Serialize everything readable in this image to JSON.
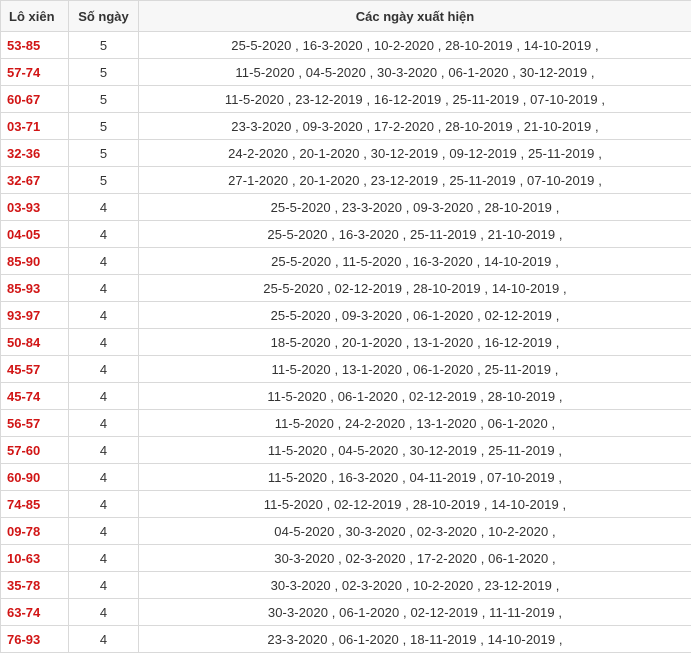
{
  "columns": {
    "pair": "Lô xiên",
    "days": "Số ngày",
    "dates": "Các ngày xuất hiện"
  },
  "colors": {
    "pair_text": "#d11515",
    "border": "#d9d9d9",
    "header_bg": "#f7f7f7"
  },
  "rows": [
    {
      "pair": "53-85",
      "days": "5",
      "dates": "25-5-2020 , 16-3-2020 , 10-2-2020 , 28-10-2019 , 14-10-2019 ,"
    },
    {
      "pair": "57-74",
      "days": "5",
      "dates": "11-5-2020 , 04-5-2020 , 30-3-2020 , 06-1-2020 , 30-12-2019 ,"
    },
    {
      "pair": "60-67",
      "days": "5",
      "dates": "11-5-2020 , 23-12-2019 , 16-12-2019 , 25-11-2019 , 07-10-2019 ,"
    },
    {
      "pair": "03-71",
      "days": "5",
      "dates": "23-3-2020 , 09-3-2020 , 17-2-2020 , 28-10-2019 , 21-10-2019 ,"
    },
    {
      "pair": "32-36",
      "days": "5",
      "dates": "24-2-2020 , 20-1-2020 , 30-12-2019 , 09-12-2019 , 25-11-2019 ,"
    },
    {
      "pair": "32-67",
      "days": "5",
      "dates": "27-1-2020 , 20-1-2020 , 23-12-2019 , 25-11-2019 , 07-10-2019 ,"
    },
    {
      "pair": "03-93",
      "days": "4",
      "dates": "25-5-2020 , 23-3-2020 , 09-3-2020 , 28-10-2019 ,"
    },
    {
      "pair": "04-05",
      "days": "4",
      "dates": "25-5-2020 , 16-3-2020 , 25-11-2019 , 21-10-2019 ,"
    },
    {
      "pair": "85-90",
      "days": "4",
      "dates": "25-5-2020 , 11-5-2020 , 16-3-2020 , 14-10-2019 ,"
    },
    {
      "pair": "85-93",
      "days": "4",
      "dates": "25-5-2020 , 02-12-2019 , 28-10-2019 , 14-10-2019 ,"
    },
    {
      "pair": "93-97",
      "days": "4",
      "dates": "25-5-2020 , 09-3-2020 , 06-1-2020 , 02-12-2019 ,"
    },
    {
      "pair": "50-84",
      "days": "4",
      "dates": "18-5-2020 , 20-1-2020 , 13-1-2020 , 16-12-2019 ,"
    },
    {
      "pair": "45-57",
      "days": "4",
      "dates": "11-5-2020 , 13-1-2020 , 06-1-2020 , 25-11-2019 ,"
    },
    {
      "pair": "45-74",
      "days": "4",
      "dates": "11-5-2020 , 06-1-2020 , 02-12-2019 , 28-10-2019 ,"
    },
    {
      "pair": "56-57",
      "days": "4",
      "dates": "11-5-2020 , 24-2-2020 , 13-1-2020 , 06-1-2020 ,"
    },
    {
      "pair": "57-60",
      "days": "4",
      "dates": "11-5-2020 , 04-5-2020 , 30-12-2019 , 25-11-2019 ,"
    },
    {
      "pair": "60-90",
      "days": "4",
      "dates": "11-5-2020 , 16-3-2020 , 04-11-2019 , 07-10-2019 ,"
    },
    {
      "pair": "74-85",
      "days": "4",
      "dates": "11-5-2020 , 02-12-2019 , 28-10-2019 , 14-10-2019 ,"
    },
    {
      "pair": "09-78",
      "days": "4",
      "dates": "04-5-2020 , 30-3-2020 , 02-3-2020 , 10-2-2020 ,"
    },
    {
      "pair": "10-63",
      "days": "4",
      "dates": "30-3-2020 , 02-3-2020 , 17-2-2020 , 06-1-2020 ,"
    },
    {
      "pair": "35-78",
      "days": "4",
      "dates": "30-3-2020 , 02-3-2020 , 10-2-2020 , 23-12-2019 ,"
    },
    {
      "pair": "63-74",
      "days": "4",
      "dates": "30-3-2020 , 06-1-2020 , 02-12-2019 , 11-11-2019 ,"
    },
    {
      "pair": "76-93",
      "days": "4",
      "dates": "23-3-2020 , 06-1-2020 , 18-11-2019 , 14-10-2019 ,"
    }
  ]
}
